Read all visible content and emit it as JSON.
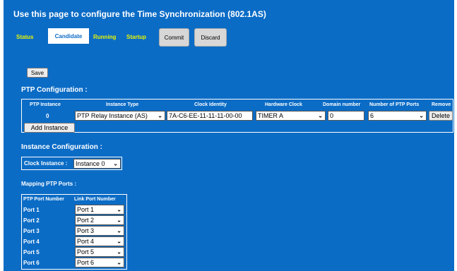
{
  "page_title": "Use this page to configure the Time Synchronization (802.1AS)",
  "tabs": {
    "status": "Status",
    "candidate": "Candidate",
    "running": "Running",
    "startup": "Startup"
  },
  "actions": {
    "commit": "Commit",
    "discard": "Discard",
    "save": "Save"
  },
  "ptp_configuration": {
    "heading": "PTP Configuration :",
    "headers": {
      "instance": "PTP Instance",
      "instance_type": "Instance Type",
      "clock_identity": "Clock Identity",
      "hardware_clock": "Hardware Clock",
      "domain_number": "Domain number",
      "num_ports": "Number of PTP Ports",
      "remove": "Remove"
    },
    "row": {
      "instance": "0",
      "instance_type": "PTP Relay Instance (AS)",
      "clock_identity": "7A-C6-EE-11-11-11-00-00",
      "hardware_clock": "TIMER A",
      "domain_number": "0",
      "num_ports": "6",
      "delete": "Delete"
    },
    "add_instance": "Add Instance"
  },
  "instance_configuration": {
    "heading": "Instance Configuration :",
    "clock_instance_label": "Clock Instance :",
    "clock_instance_value": "Instance 0"
  },
  "mapping": {
    "heading": "Mapping PTP Ports :",
    "headers": {
      "ptp_port": "PTP Port Number",
      "link_port": "Link Port Number"
    },
    "rows": [
      {
        "ptp_port": "Port 1",
        "link_port": "Port 1"
      },
      {
        "ptp_port": "Port 2",
        "link_port": "Port 2"
      },
      {
        "ptp_port": "Port 3",
        "link_port": "Port 3"
      },
      {
        "ptp_port": "Port 4",
        "link_port": "Port 4"
      },
      {
        "ptp_port": "Port 5",
        "link_port": "Port 5"
      },
      {
        "ptp_port": "Port 6",
        "link_port": "Port 6"
      }
    ]
  },
  "colors": {
    "panel_bg": "#0b6cc6",
    "tab_link": "#e8f400",
    "button_gray": "#d7d7d7"
  }
}
